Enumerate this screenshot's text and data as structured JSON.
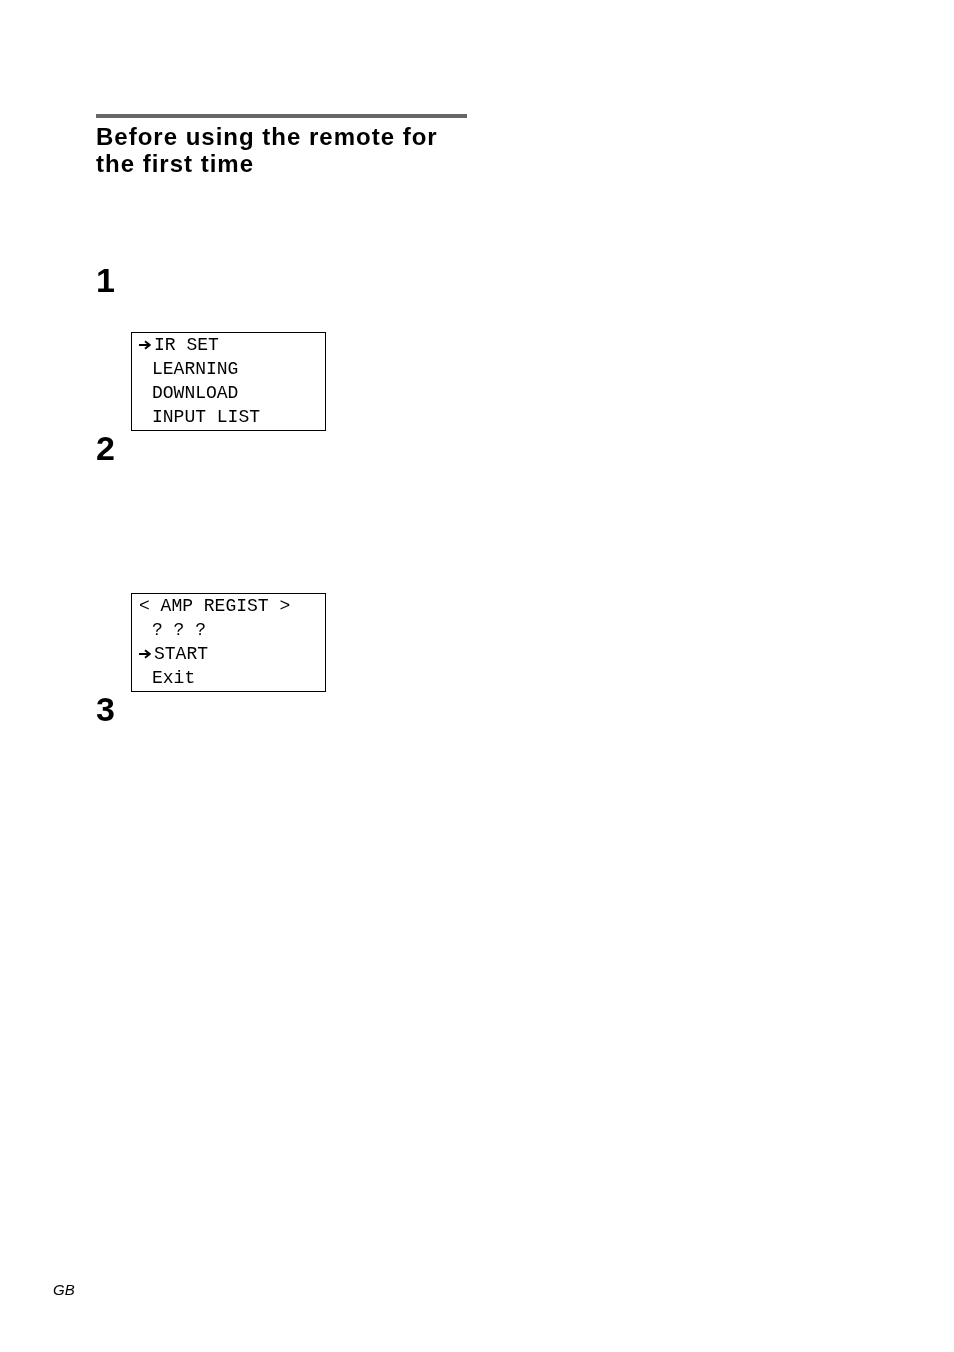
{
  "section": {
    "title": "Before using the remote for the first time"
  },
  "steps": [
    {
      "number": "1",
      "screen": {
        "lines": [
          {
            "kind": "item",
            "text": "IR SET",
            "selected": true
          },
          {
            "kind": "item",
            "text": "LEARNING",
            "selected": false
          },
          {
            "kind": "item",
            "text": "DOWNLOAD",
            "selected": false
          },
          {
            "kind": "item",
            "text": "INPUT LIST",
            "selected": false
          }
        ]
      }
    },
    {
      "number": "2",
      "screen": {
        "lines": [
          {
            "kind": "title",
            "text": "< AMP REGIST >"
          },
          {
            "kind": "item",
            "text": "? ? ?",
            "selected": false
          },
          {
            "kind": "item",
            "text": "START",
            "selected": true
          },
          {
            "kind": "item",
            "text": "Exit",
            "selected": false
          }
        ]
      }
    },
    {
      "number": "3"
    }
  ],
  "footer": {
    "region": "GB"
  }
}
